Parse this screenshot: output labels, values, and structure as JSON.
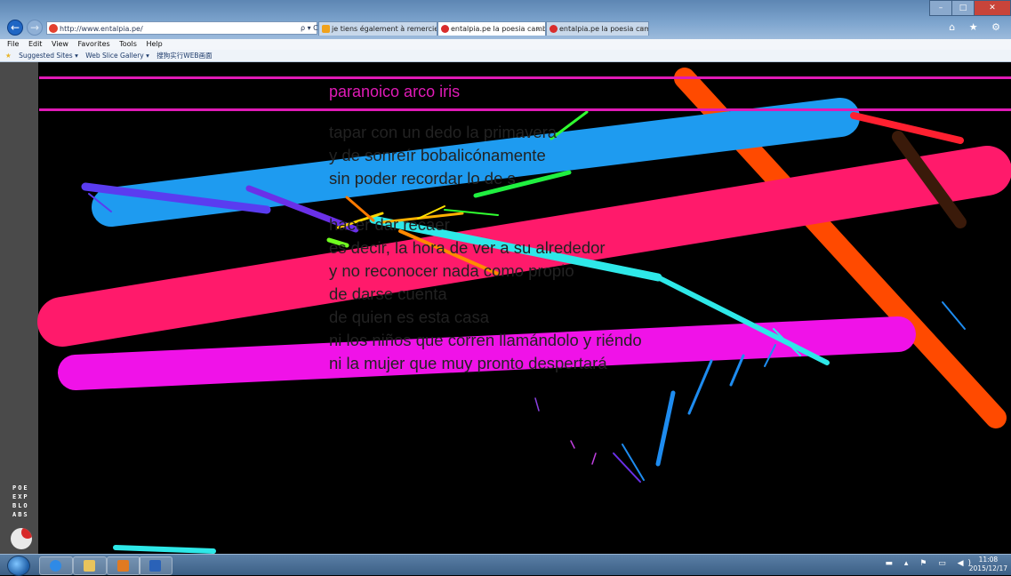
{
  "browser": {
    "address": "http://www.entalpia.pe/",
    "address_tools": "ρ ▾ C",
    "tabs": [
      {
        "label": "je tiens également à remercier ..."
      },
      {
        "label": "entalpia.pe la poesia cambi...",
        "close": "×"
      },
      {
        "label": "entalpia.pe la poesia cambi...",
        "close": "×"
      }
    ],
    "right_icons": "⌂ ★ ⚙",
    "window_controls": {
      "min": "–",
      "max": "□",
      "close": "✕"
    }
  },
  "menu": {
    "items": [
      "File",
      "Edit",
      "View",
      "Favorites",
      "Tools",
      "Help"
    ]
  },
  "favorites": {
    "items": [
      "Suggested Sites ▾",
      "Web Slice Gallery ▾",
      "搜狗实行WEB画面"
    ]
  },
  "page": {
    "title": "paranoico arco iris",
    "poem": [
      "          tapar con un dedo la primavera",
      "y de sonreír bobalicónamente",
      "sin poder recordar lo de s",
      "  ",
      "  hacer   dar   recaer",
      "es decir, la hora de ver a su alrededor",
      "y no reconocer nada como propio",
      "de darse cuenta",
      "de quien es esta casa",
      "ni los niños que corren llamándolo y riéndo",
      "ni la mujer que muy pronto despertará"
    ],
    "logo_lines": [
      "POE",
      "EXP",
      "BLO",
      "ABS"
    ]
  },
  "colors": {
    "magenta": "#e01ab6",
    "blue_stroke": "#1e9bf0",
    "pink_stroke": "#ff1a6b",
    "fuchsia_stroke": "#f012e8",
    "orange_stroke": "#ff4a00",
    "cyan_stroke": "#2ee8e8"
  },
  "taskbar": {
    "clock_time": "11:08",
    "clock_date": "2015/12/17",
    "tray": "▬ ▴ ⚑ ▭ ◀)"
  }
}
